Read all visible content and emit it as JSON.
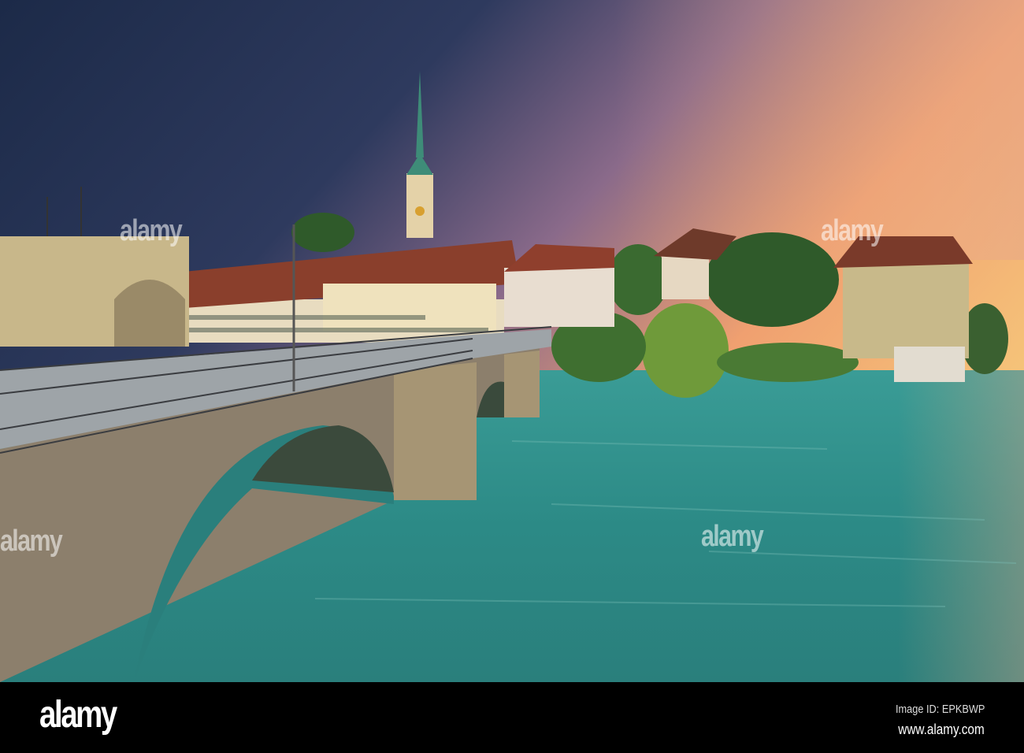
{
  "photo": {
    "subject": "Bern old town with Nydegg church and Untertor bridge over the Aare river at sunset",
    "colors": {
      "sky_top": "#1e2c4a",
      "sky_sunset": "#f4a66a",
      "river": "#2f8f8a",
      "stone": "#8c7f6c",
      "roof": "#8a3f2c"
    }
  },
  "watermark": {
    "text": "alamy"
  },
  "footer": {
    "logo": "alamy",
    "image_id": "Image ID: EPKBWP",
    "url": "www.alamy.com"
  }
}
